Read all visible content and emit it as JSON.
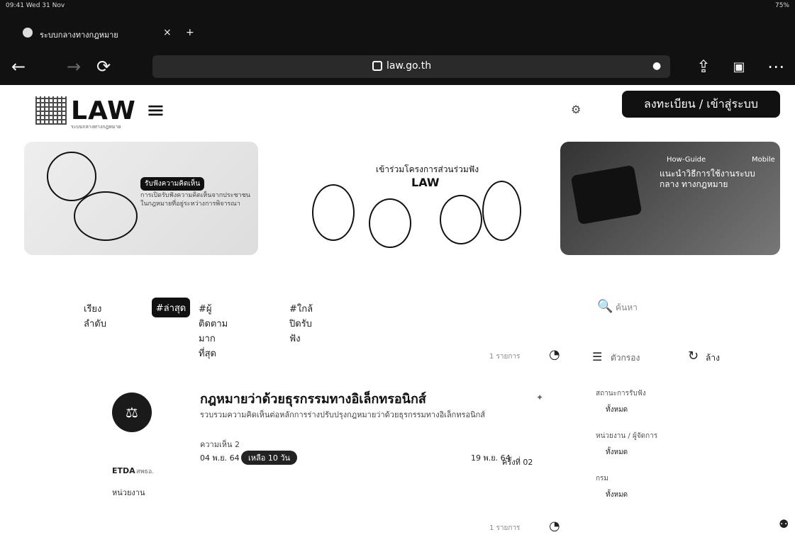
{
  "status": {
    "left": "09:41 Wed 31 Nov",
    "right": "75%"
  },
  "tab": {
    "title": "ระบบกลางทางกฎหมาย"
  },
  "address": {
    "url": "law.go.th"
  },
  "header": {
    "logo_word": "LAW",
    "logo_sub": "ระบบกลางทางกฎหมาย",
    "login_label": "ลงทะเบียน / เข้าสู่ระบบ"
  },
  "banners": [
    {
      "pill": "รับฟังความคิดเห็น",
      "desc": "การเปิดรับฟังความคิดเห็นจากประชาชนในกฎหมายที่อยู่ระหว่างการพิจารณา"
    },
    {
      "line1": "เข้าร่วมโครงการส่วนร่วมฟัง",
      "line2": "LAW"
    },
    {
      "tag1": "How-Guide",
      "tag2": "Mobile",
      "line": "แนะนำวิธีการใช้งานระบบกลาง ทางกฎหมาย"
    }
  ],
  "sort": {
    "label": "เรียงลำดับ",
    "active": "#ล่าสุด",
    "opt1": "#ผู้ติดตามมากที่สุด",
    "opt2": "#ใกล้ปิดรับฟัง"
  },
  "search": {
    "placeholder": "ค้นหา"
  },
  "filters": {
    "filter_label": "ตัวกรอง",
    "clear_label": "ล้าง"
  },
  "list": {
    "count_text": "1 รายการ",
    "item": {
      "title": "กฎหมายว่าด้วยธุรกรรมทางอิเล็กทรอนิกส์",
      "desc": "รวบรวมความคิดเห็นต่อหลักการร่างปรับปรุงกฎหมายว่าด้วยธุรกรรมทางอิเล็กทรอนิกส์",
      "meta": "ความเห็น 2",
      "date_start": "04 พ.ย. 64",
      "badge": "เหลือ 10 วัน",
      "date_end": "19 พ.ย. 64",
      "round": "ครั้งที่ 02",
      "org": "ETDA",
      "org_sub": "สพธอ.",
      "agency": "หน่วยงาน"
    }
  },
  "sidebar": {
    "sections": [
      {
        "h": "สถานะการรับฟัง",
        "v": "ทั้งหมด"
      },
      {
        "h": "หน่วยงาน / ผู้จัดการ",
        "v": "ทั้งหมด"
      },
      {
        "h": "กรม",
        "v": "ทั้งหมด"
      }
    ]
  },
  "next": {
    "count_text": "1 รายการ"
  }
}
